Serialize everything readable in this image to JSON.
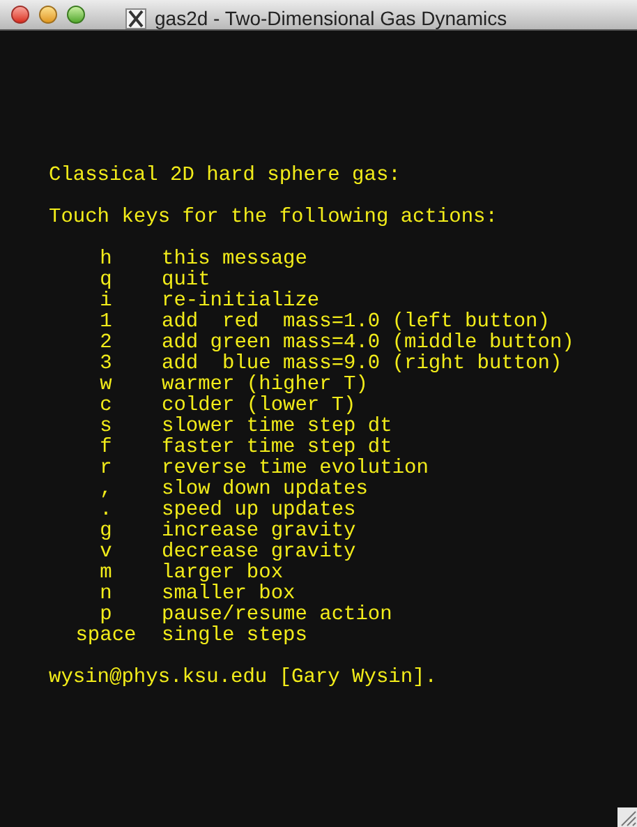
{
  "window": {
    "title": "gas2d - Two-Dimensional Gas Dynamics"
  },
  "heading": "Classical 2D hard sphere gas:",
  "intro": "Touch keys for the following actions:",
  "keys": [
    {
      "key": "h",
      "action": "this message"
    },
    {
      "key": "q",
      "action": "quit"
    },
    {
      "key": "i",
      "action": "re-initialize"
    },
    {
      "key": "1",
      "action": "add  red  mass=1.0 (left button)"
    },
    {
      "key": "2",
      "action": "add green mass=4.0 (middle button)"
    },
    {
      "key": "3",
      "action": "add  blue mass=9.0 (right button)"
    },
    {
      "key": "w",
      "action": "warmer (higher T)"
    },
    {
      "key": "c",
      "action": "colder (lower T)"
    },
    {
      "key": "s",
      "action": "slower time step dt"
    },
    {
      "key": "f",
      "action": "faster time step dt"
    },
    {
      "key": "r",
      "action": "reverse time evolution"
    },
    {
      "key": ",",
      "action": "slow down updates"
    },
    {
      "key": ".",
      "action": "speed up updates"
    },
    {
      "key": "g",
      "action": "increase gravity"
    },
    {
      "key": "v",
      "action": "decrease gravity"
    },
    {
      "key": "m",
      "action": "larger box"
    },
    {
      "key": "n",
      "action": "smaller box"
    },
    {
      "key": "p",
      "action": "pause/resume action"
    },
    {
      "key": "space",
      "action": "single steps"
    }
  ],
  "footer": "wysin@phys.ksu.edu [Gary Wysin]."
}
